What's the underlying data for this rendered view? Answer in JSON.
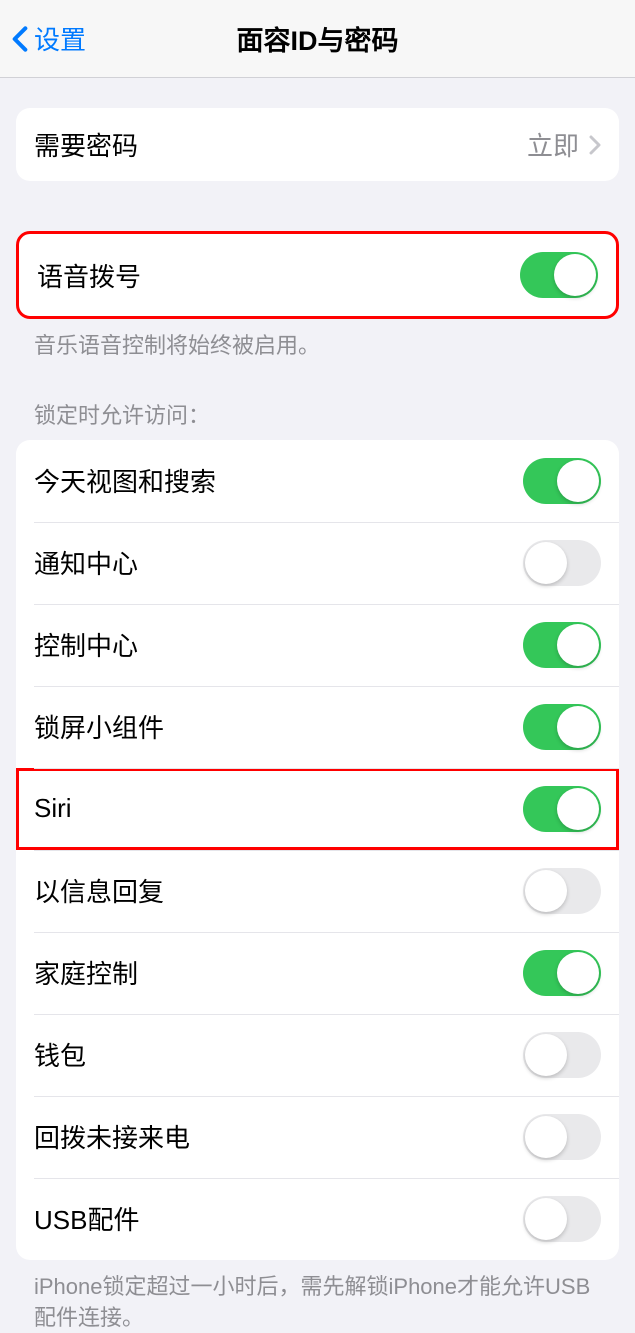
{
  "header": {
    "back_label": "设置",
    "title": "面容ID与密码"
  },
  "passcode_section": {
    "require_passcode": {
      "label": "需要密码",
      "value": "立即"
    }
  },
  "voice_dial": {
    "label": "语音拨号",
    "enabled": true,
    "footer": "音乐语音控制将始终被启用。"
  },
  "lock_access": {
    "header": "锁定时允许访问：",
    "items": [
      {
        "label": "今天视图和搜索",
        "enabled": true
      },
      {
        "label": "通知中心",
        "enabled": false
      },
      {
        "label": "控制中心",
        "enabled": true
      },
      {
        "label": "锁屏小组件",
        "enabled": true
      },
      {
        "label": "Siri",
        "enabled": true
      },
      {
        "label": "以信息回复",
        "enabled": false
      },
      {
        "label": "家庭控制",
        "enabled": true
      },
      {
        "label": "钱包",
        "enabled": false
      },
      {
        "label": "回拨未接来电",
        "enabled": false
      },
      {
        "label": "USB配件",
        "enabled": false
      }
    ],
    "footer": "iPhone锁定超过一小时后，需先解锁iPhone才能允许USB配件连接。"
  }
}
